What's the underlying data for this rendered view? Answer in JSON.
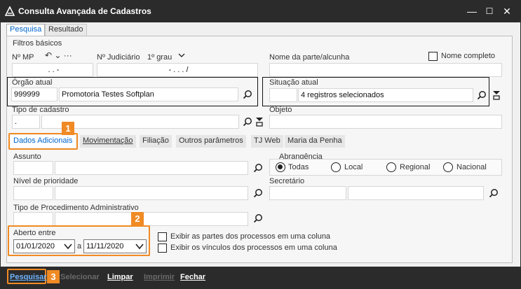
{
  "window": {
    "title": "Consulta Avançada de Cadastros",
    "minimize": "—",
    "maximize": "☐",
    "close": "✕"
  },
  "tabs": [
    {
      "label": "Pesquisa",
      "active": true
    },
    {
      "label": "Resultado",
      "active": false
    }
  ],
  "section": {
    "title": "Filtros básicos"
  },
  "fields": {
    "nmp_label": "Nº MP",
    "nmp_value": ". . -",
    "nmp_tools": "↶ ⌄ ···",
    "njud_label": "Nº Judiciário",
    "njud_grau": "1º grau",
    "njud_value": "- . . . /",
    "nome_label": "Nome da parte/alcunha",
    "nome_value": "",
    "nome_completo": "Nome completo",
    "orgao_label": "Órgão atual",
    "orgao_code": "999999",
    "orgao_name": "Promotoria Testes Softplan",
    "situacao_label": "Situação atual",
    "situacao_code": "",
    "situacao_value": "4 registros selecionados",
    "tipo_label": "Tipo de cadastro",
    "tipo_code": ".",
    "tipo_value": "",
    "objeto_label": "Objeto",
    "objeto_value": ""
  },
  "subtabs": [
    {
      "label": "Dados Adicionais",
      "active": true
    },
    {
      "label": "Movimentação",
      "active": false
    },
    {
      "label": "Filiação",
      "active": false
    },
    {
      "label": "Outros parâmetros",
      "active": false
    },
    {
      "label": "TJ Web",
      "active": false
    },
    {
      "label": "Maria da Penha",
      "active": false
    }
  ],
  "adicionais": {
    "assunto_label": "Assunto",
    "abrangencia_label": "Abrangência",
    "abrangencia_options": [
      "Todas",
      "Local",
      "Regional",
      "Nacional"
    ],
    "abrangencia_selected": "Todas",
    "prioridade_label": "Nível de prioridade",
    "secretario_label": "Secretário",
    "procedimento_label": "Tipo de Procedimento Administrativo",
    "aberto_label": "Aberto entre",
    "date_from": "01/01/2020",
    "date_sep": "a",
    "date_to": "11/11/2020",
    "check1": "Exibir as partes dos processos em uma coluna",
    "check2": "Exibir os vínculos dos processos em uma coluna"
  },
  "badges": [
    "1",
    "2",
    "3"
  ],
  "bottom": {
    "pesquisar": "Pesquisar",
    "selecionar": "Selecionar",
    "limpar": "Limpar",
    "imprimir": "Imprimir",
    "fechar": "Fechar"
  },
  "colors": {
    "accent": "#f08a24",
    "tab_active": "#0066cc",
    "chrome": "#2b2b2b"
  }
}
